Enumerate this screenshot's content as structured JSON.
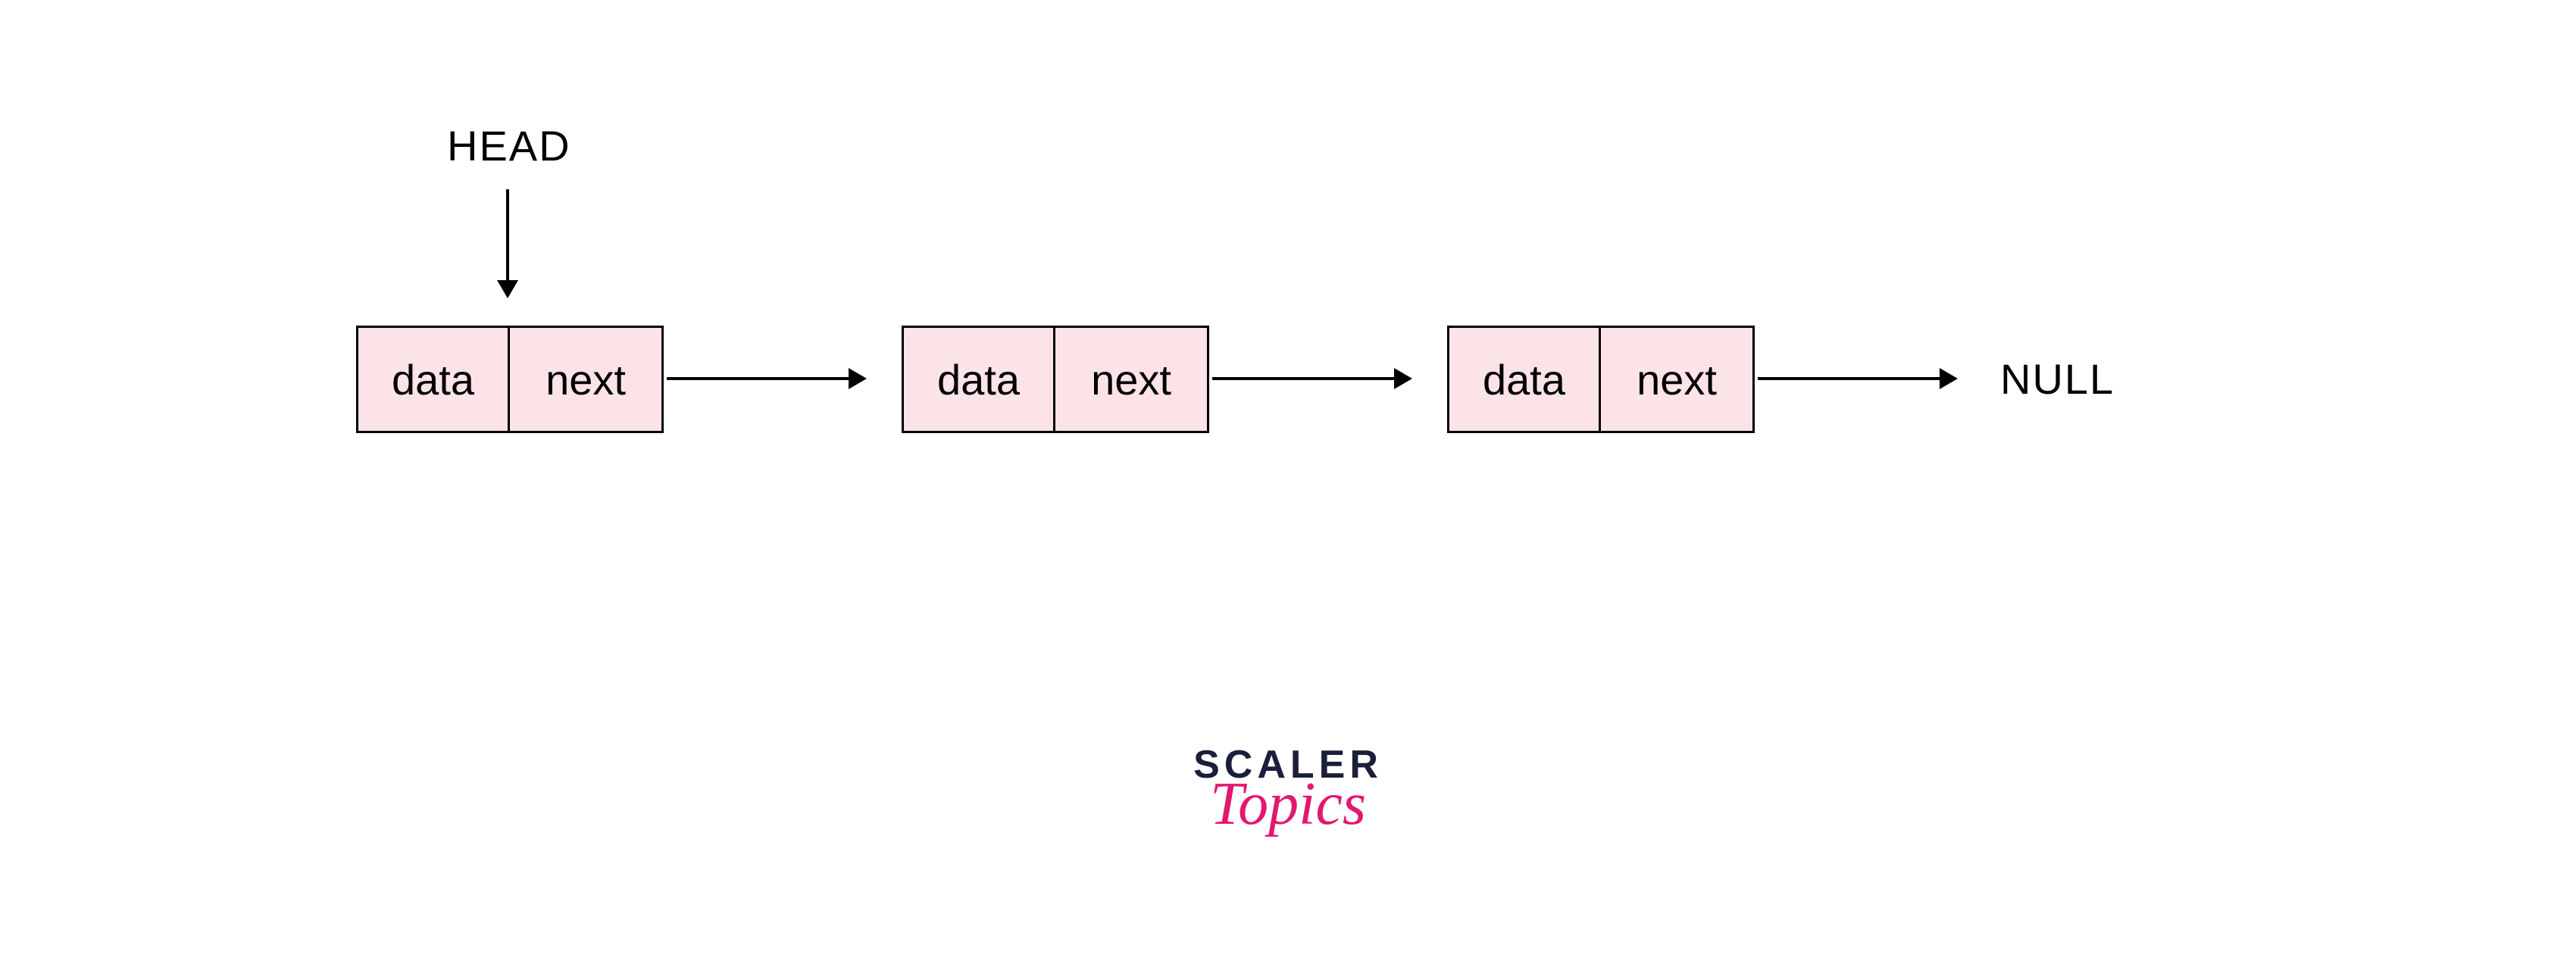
{
  "diagram": {
    "head_label": "HEAD",
    "null_label": "NULL",
    "nodes": [
      {
        "data_label": "data",
        "next_label": "next"
      },
      {
        "data_label": "data",
        "next_label": "next"
      },
      {
        "data_label": "data",
        "next_label": "next"
      }
    ]
  },
  "branding": {
    "line1": "SCALER",
    "line2": "Topics"
  },
  "colors": {
    "node_fill": "#fbe3e8",
    "node_border": "#000000",
    "text": "#000000",
    "logo_dark": "#1b1f3b",
    "logo_accent": "#e21870"
  }
}
